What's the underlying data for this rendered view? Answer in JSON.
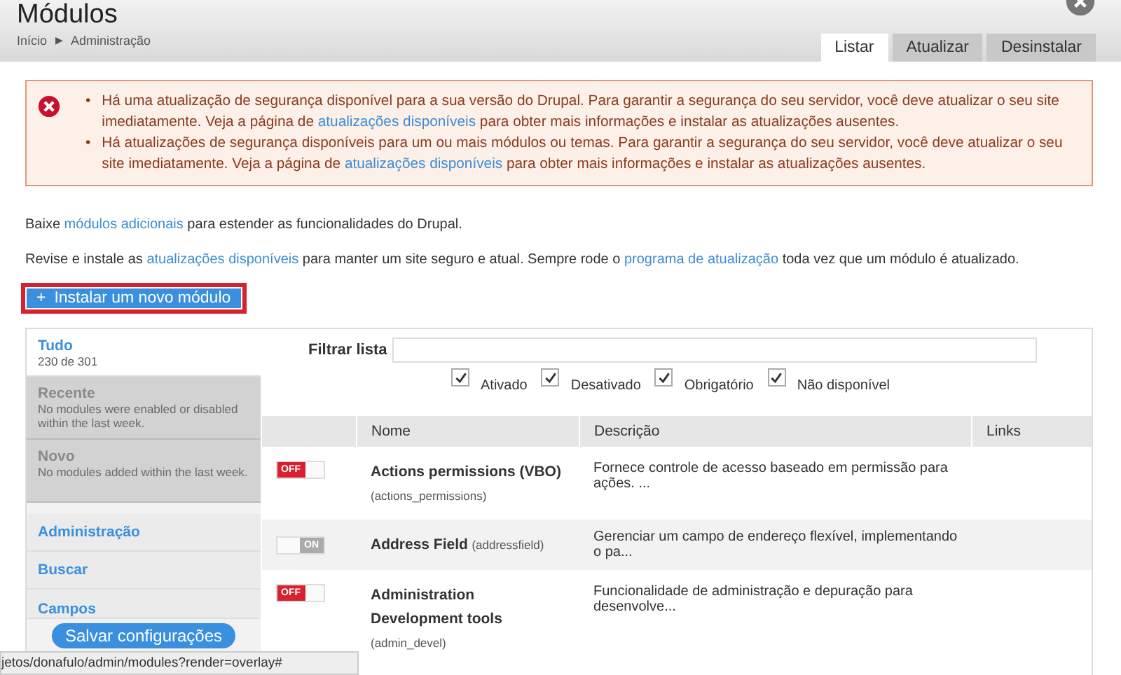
{
  "header": {
    "title": "Módulos",
    "breadcrumb": [
      {
        "label": "Início"
      },
      {
        "label": "Administração"
      }
    ],
    "breadcrumb_separator": "▶"
  },
  "tabs": [
    {
      "label": "Listar",
      "selected": true
    },
    {
      "label": "Atualizar",
      "selected": false
    },
    {
      "label": "Desinstalar",
      "selected": false
    }
  ],
  "error_messages": [
    {
      "bullet": "•",
      "before": "Há uma atualização de segurança disponível para a sua versão do Drupal. Para garantir a segurança do seu servidor, você deve atualizar o seu site imediatamente. Veja a página de ",
      "link": "atualizações disponíveis",
      "after": " para obter mais informações e instalar as atualizações ausentes."
    },
    {
      "bullet": "•",
      "before": "Há atualizações de segurança disponíveis para um ou mais módulos ou temas. Para garantir a segurança do seu servidor, você deve atualizar o seu site imediatamente. Veja a página de ",
      "link": "atualizações disponíveis",
      "after": " para obter mais informações e instalar as atualizações ausentes."
    }
  ],
  "intro": [
    {
      "parts": [
        {
          "text": "Baixe "
        },
        {
          "link": "módulos adicionais"
        },
        {
          "text": " para estender as funcionalidades do Drupal."
        }
      ]
    },
    {
      "parts": [
        {
          "text": "Revise e instale as "
        },
        {
          "link": "atualizações disponíveis"
        },
        {
          "text": " para manter um site seguro e atual. Sempre rode o "
        },
        {
          "link": "programa de atualização"
        },
        {
          "text": " toda vez que um módulo é atualizado."
        }
      ]
    }
  ],
  "install_button": {
    "icon": "+",
    "label": "Instalar um novo módulo"
  },
  "sidebar": {
    "items": [
      {
        "title": "Tudo",
        "subtitle": "230 de 301",
        "selected": true,
        "disabled": false
      },
      {
        "title": "Recente",
        "subtitle": "No modules were enabled or disabled within the last week.",
        "selected": false,
        "disabled": true
      },
      {
        "title": "Novo",
        "subtitle": "No modules added within the last week.",
        "selected": false,
        "disabled": true
      },
      {
        "title": "Administração",
        "selected": false,
        "disabled": false
      },
      {
        "title": "Buscar",
        "selected": false,
        "disabled": false
      },
      {
        "title": "Campos",
        "selected": false,
        "disabled": false
      }
    ],
    "save_button": "Salvar configurações"
  },
  "filter": {
    "label": "Filtrar lista",
    "options": [
      {
        "label": "Ativado",
        "checked": true
      },
      {
        "label": "Desativado",
        "checked": true
      },
      {
        "label": "Obrigatório",
        "checked": true
      },
      {
        "label": "Não disponível",
        "checked": true
      }
    ]
  },
  "table": {
    "columns": [
      "Nome",
      "Descrição",
      "Links"
    ],
    "rows": [
      {
        "enabled": false,
        "toggle_label": "OFF",
        "name": "Actions permissions (VBO)",
        "machine_name": "(actions_permissions)",
        "description": "Fornece controle de acesso baseado em permissão para ações. ..."
      },
      {
        "enabled": true,
        "toggle_label": "ON",
        "name": "Address Field",
        "machine_name": "(addressfield)",
        "description": "Gerenciar um campo de endereço flexível, implementando o pa..."
      },
      {
        "enabled": false,
        "toggle_label": "OFF",
        "name": "Administration Development tools",
        "machine_name": "(admin_devel)",
        "description": "Funcionalidade de administração e depuração para desenvolve..."
      }
    ]
  },
  "status_bar": "jetos/donafulo/admin/modules?render=overlay#"
}
